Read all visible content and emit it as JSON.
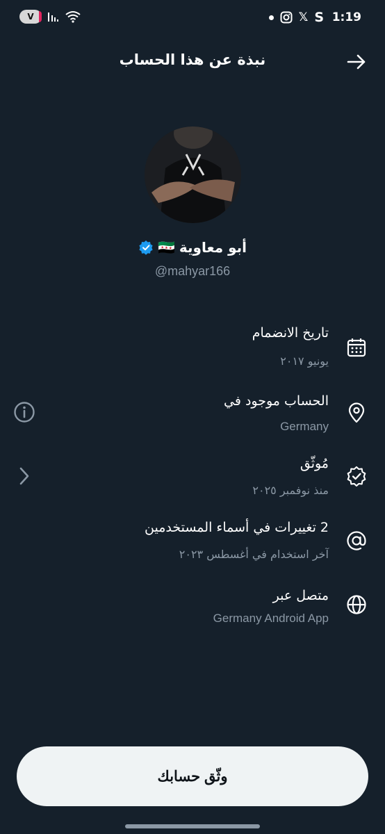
{
  "status_bar": {
    "time": "1:19",
    "battery": "V",
    "app_letter": "S",
    "x_glyph": "𝕏"
  },
  "header": {
    "title": "نبذة عن هذا الحساب"
  },
  "profile": {
    "name": "أبو معاوية",
    "flag": "🇸🇾",
    "handle": "@mahyar166"
  },
  "rows": [
    {
      "title": "تاريخ الانضمام",
      "subtitle": "يونيو ٢٠١٧",
      "icon": "calendar-icon"
    },
    {
      "title": "الحساب موجود في",
      "subtitle": "Germany",
      "icon": "location-pin-icon"
    },
    {
      "title": "مُوثّق",
      "subtitle": "منذ نوفمبر ٢٠٢٥",
      "icon": "verified-badge-icon"
    },
    {
      "title": "2 تغييرات في أسماء المستخدمين",
      "subtitle": "آخر استخدام في أغسطس ٢٠٢٣",
      "icon": "at-sign-icon"
    },
    {
      "title": "متصل عبر",
      "subtitle": "Germany Android App",
      "icon": "globe-icon"
    }
  ],
  "verify_button": {
    "label": "وثّق حسابك"
  },
  "colors": {
    "background": "#15202b",
    "text_secondary": "#8b98a5",
    "verified_blue": "#1d9bf0",
    "button_bg": "#eff3f4"
  }
}
